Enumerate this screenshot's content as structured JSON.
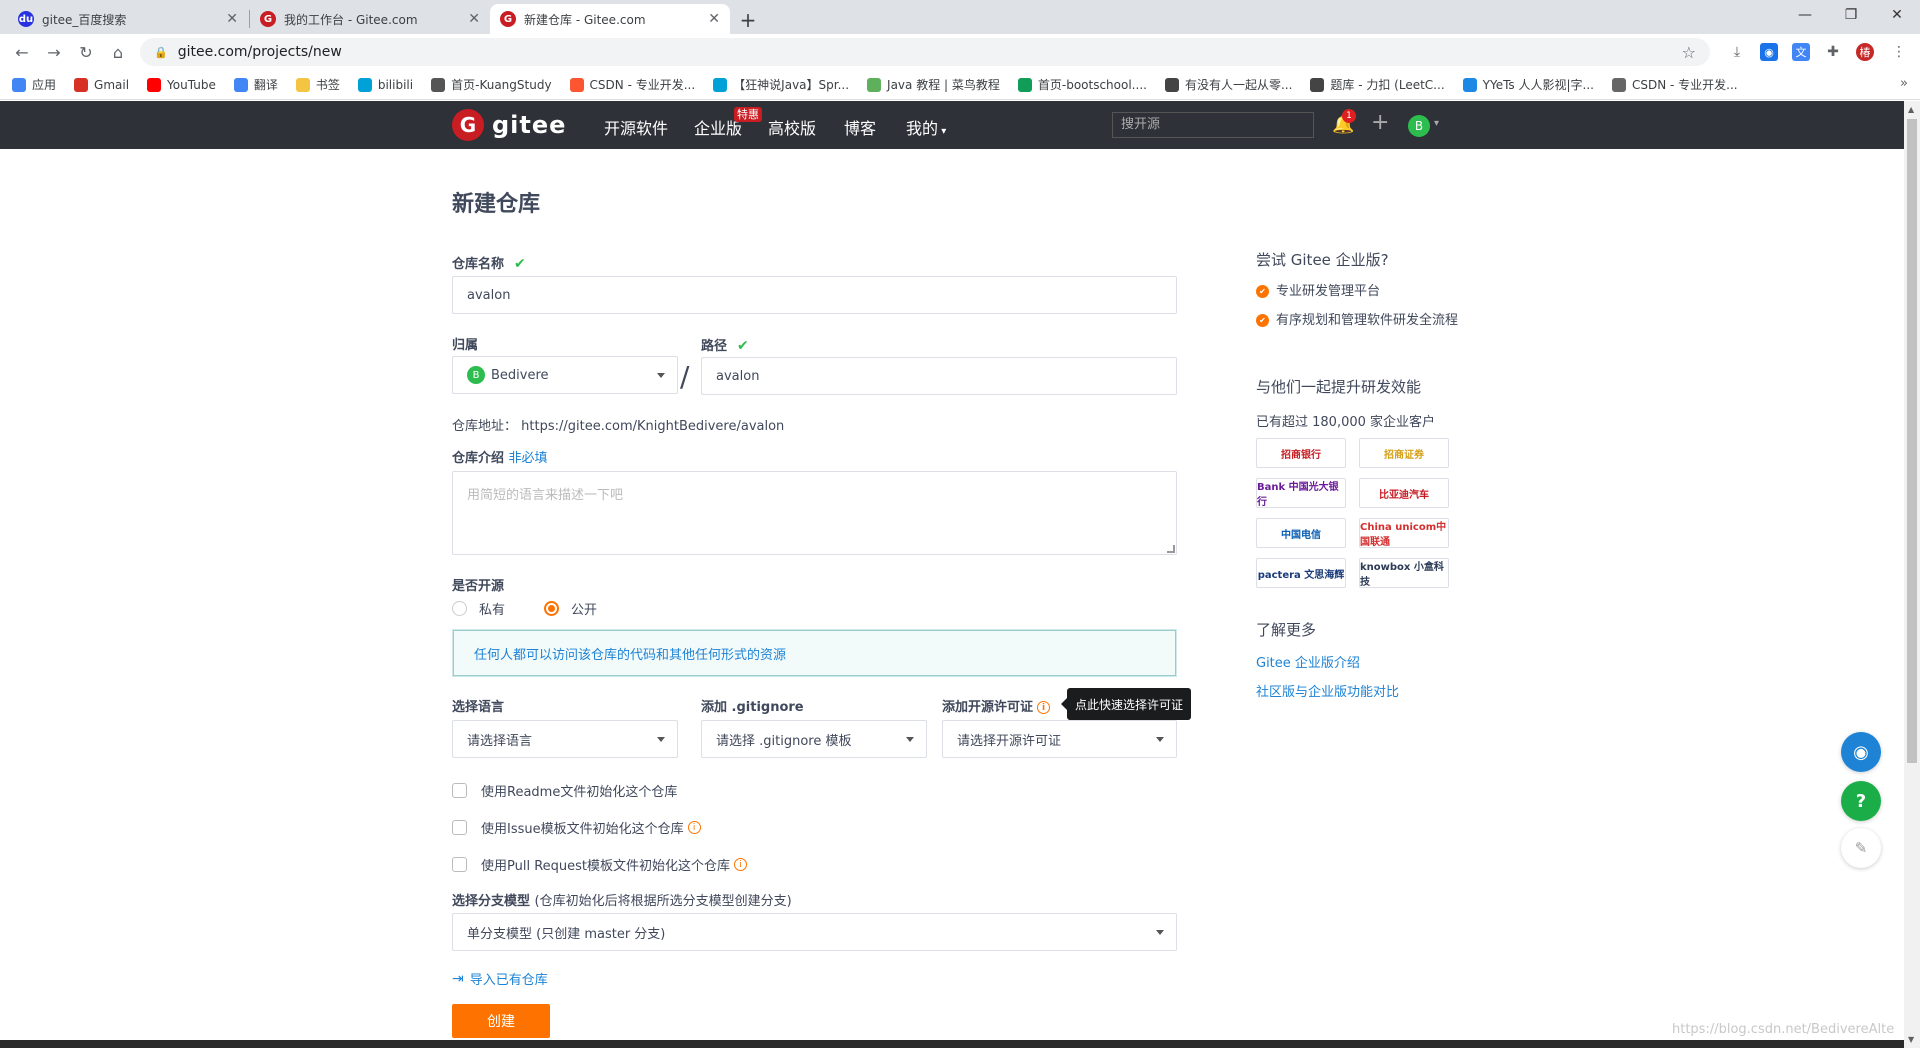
{
  "browser": {
    "tabs": [
      {
        "title": "gitee_百度搜索",
        "favicon": "baidu-icon"
      },
      {
        "title": "我的工作台 - Gitee.com",
        "favicon": "gitee-icon"
      },
      {
        "title": "新建仓库 - Gitee.com",
        "favicon": "gitee-icon",
        "active": true
      }
    ],
    "url": "gitee.com/projects/new",
    "profile_initial": "椿",
    "bookmarks": [
      {
        "label": "应用",
        "icon": "apps-icon",
        "color": "#4285f4"
      },
      {
        "label": "Gmail",
        "icon": "gmail-icon",
        "color": "#d93025"
      },
      {
        "label": "YouTube",
        "icon": "youtube-icon",
        "color": "#ff0000"
      },
      {
        "label": "翻译",
        "icon": "translate-icon",
        "color": "#4285f4"
      },
      {
        "label": "书签",
        "icon": "folder-icon",
        "color": "#f4c542"
      },
      {
        "label": "bilibili",
        "icon": "bilibili-icon",
        "color": "#00a1d6"
      },
      {
        "label": "首页-KuangStudy",
        "icon": "kuangstudy-icon",
        "color": "#555555"
      },
      {
        "label": "CSDN - 专业开发...",
        "icon": "csdn-icon",
        "color": "#fc5531"
      },
      {
        "label": "【狂神说Java】Spr...",
        "icon": "bilibili-icon",
        "color": "#00a1d6"
      },
      {
        "label": "Java 教程 | 菜鸟教程",
        "icon": "runoob-icon",
        "color": "#5fb05c"
      },
      {
        "label": "首页-bootschool....",
        "icon": "bootschool-icon",
        "color": "#0f9d58"
      },
      {
        "label": "有没有人一起从零...",
        "icon": "leetcode-icon",
        "color": "#444444"
      },
      {
        "label": "题库 - 力扣 (LeetC...",
        "icon": "leetcode-icon",
        "color": "#444444"
      },
      {
        "label": "YYeTs 人人影视|字...",
        "icon": "yyets-icon",
        "color": "#1e88e5"
      },
      {
        "label": "CSDN - 专业开发...",
        "icon": "globe-icon",
        "color": "#666666"
      }
    ]
  },
  "header": {
    "logo_text": "gitee",
    "nav": [
      "开源软件",
      "企业版",
      "高校版",
      "博客",
      "我的"
    ],
    "promo_badge": "特惠",
    "search_placeholder": "搜开源",
    "notification_count": "1",
    "avatar_initial": "B"
  },
  "form": {
    "title": "新建仓库",
    "repo_name_label": "仓库名称",
    "repo_name_value": "avalon",
    "owner_label": "归属",
    "owner_value": "Bedivere",
    "owner_initial": "B",
    "path_label": "路径",
    "path_value": "avalon",
    "slash": "/",
    "repo_address_label": "仓库地址：",
    "repo_address_value": "https://gitee.com/KnightBedivere/avalon",
    "intro_label": "仓库介绍",
    "intro_optional": "非必填",
    "intro_placeholder": "用简短的语言来描述一下吧",
    "open_source_label": "是否开源",
    "radio_private": "私有",
    "radio_public": "公开",
    "visibility_selected": "公开",
    "public_notice": "任何人都可以访问该仓库的代码和其他任何形式的资源",
    "language_label": "选择语言",
    "language_placeholder": "请选择语言",
    "gitignore_label": "添加 .gitignore",
    "gitignore_placeholder": "请选择 .gitignore 模板",
    "license_label": "添加开源许可证",
    "license_placeholder": "请选择开源许可证",
    "license_tooltip": "点此快速选择许可证",
    "checkbox_readme": "使用Readme文件初始化这个仓库",
    "checkbox_issue": "使用Issue模板文件初始化这个仓库",
    "checkbox_pr": "使用Pull Request模板文件初始化这个仓库",
    "branch_label": "选择分支模型",
    "branch_hint": "(仓库初始化后将根据所选分支模型创建分支)",
    "branch_value": "单分支模型 (只创建 master 分支)",
    "import_link": "导入已有仓库",
    "create_button": "创建"
  },
  "sidebar": {
    "try_title": "尝试 Gitee 企业版?",
    "features": [
      "专业研发管理平台",
      "有序规划和管理软件研发全流程"
    ],
    "together_title": "与他们一起提升研发效能",
    "customers_text": "已有超过 180,000 家企业客户",
    "logos": [
      {
        "name": "招商银行",
        "color": "#c71d23"
      },
      {
        "name": "招商证券",
        "color": "#d4a017"
      },
      {
        "name": "Bank 中国光大银行",
        "color": "#6a1b9a"
      },
      {
        "name": "比亚迪汽车",
        "color": "#c71d23"
      },
      {
        "name": "中国电信",
        "color": "#0a5fb4"
      },
      {
        "name": "China unicom中国联通",
        "color": "#d32f2f"
      },
      {
        "name": "pactera 文思海辉",
        "color": "#1a3b7a"
      },
      {
        "name": "knowbox 小盒科技",
        "color": "#2b3a55"
      }
    ],
    "learn_more_title": "了解更多",
    "links": [
      "Gitee 企业版介绍",
      "社区版与企业版功能对比"
    ]
  },
  "watermark": "https://blog.csdn.net/BedivereAlte",
  "colors": {
    "accent": "#fe7300",
    "header_bg": "#2e3138",
    "link": "#1e83d5",
    "success": "#2dbd4e",
    "brand": "#c71d23"
  }
}
